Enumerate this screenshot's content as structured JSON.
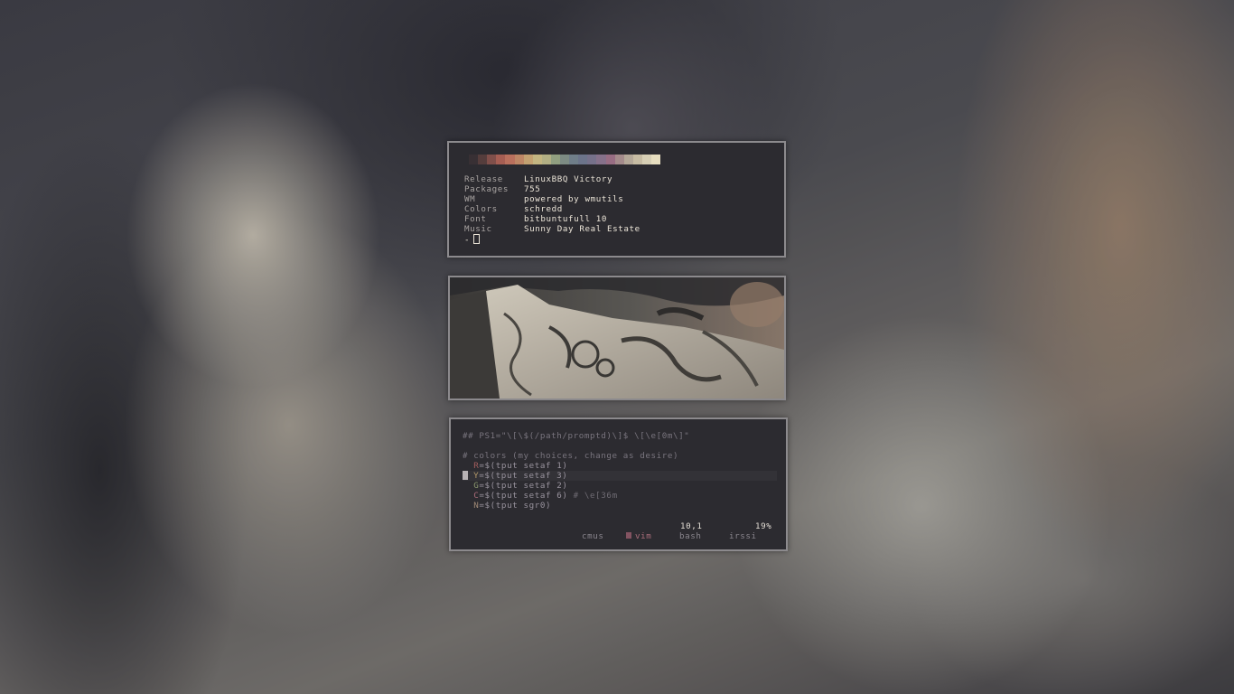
{
  "palette": [
    "#2c2b31",
    "#3a3034",
    "#5a3c3a",
    "#8a4c46",
    "#b55a4d",
    "#c96c55",
    "#c9845a",
    "#caa064",
    "#c7b574",
    "#b3b07a",
    "#8fa07a",
    "#7a8c82",
    "#6d7f8c",
    "#6a748f",
    "#76708f",
    "#8a6f8f",
    "#a06a86",
    "#a98a8a",
    "#b7a894",
    "#c9bc9d",
    "#d9cfae",
    "#e8ddb8"
  ],
  "info": {
    "rows": [
      {
        "key": "Release",
        "value": "LinuxBBQ Victory"
      },
      {
        "key": "Packages",
        "value": "755"
      },
      {
        "key": "WM",
        "value": "powered by wmutils"
      },
      {
        "key": "Colors",
        "value": "schredd"
      },
      {
        "key": "Font",
        "value": "bitbuntufull 10"
      },
      {
        "key": "Music",
        "value": "Sunny Day Real Estate"
      }
    ],
    "prompt": "-"
  },
  "editor": {
    "line_ps1": "## PS1=\"\\[\\$(/path/promptd)\\]$ \\[\\e[0m\\]\"",
    "line_comment": "# colors (my choices, change as desire)",
    "vars": [
      {
        "name": "R",
        "rest": "=$(tput setaf 1)",
        "trail": ""
      },
      {
        "name": "Y",
        "rest": "=$(tput setaf 3)",
        "trail": ""
      },
      {
        "name": "G",
        "rest": "=$(tput setaf 2)",
        "trail": ""
      },
      {
        "name": "C",
        "rest": "=$(tput setaf 6)",
        "trail": " # \\e[36m"
      },
      {
        "name": "N",
        "rest": "=$(tput sgr0)",
        "trail": ""
      }
    ],
    "cursor_position": "10,1",
    "scroll_percent": "19%"
  },
  "tmux": {
    "tabs": [
      "cmus",
      "vim",
      "bash",
      "irssi"
    ],
    "active_tab": "vim"
  }
}
